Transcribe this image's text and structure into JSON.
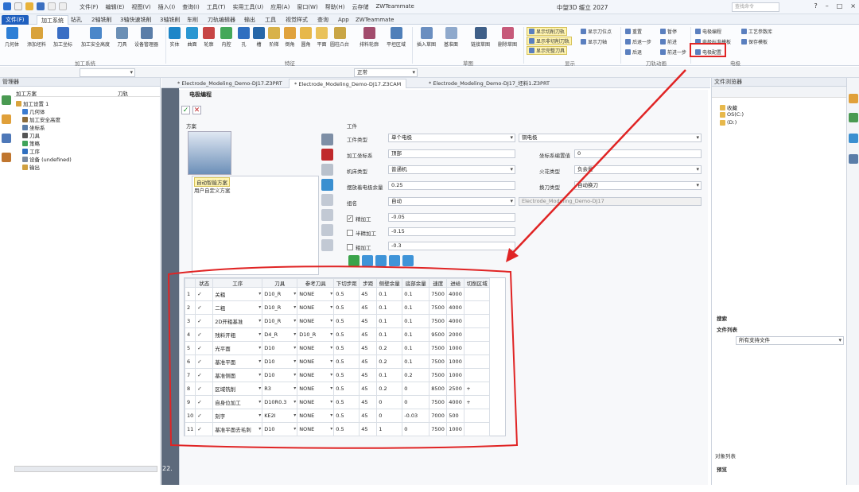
{
  "titlebar": {
    "menu": [
      "文件(F)",
      "编辑(E)",
      "视图(V)",
      "插入(I)",
      "查询(I)",
      "工具(T)",
      "实用工具(U)",
      "应用(A)",
      "窗口(W)",
      "帮助(H)",
      "云存储",
      "ZWTeammate"
    ],
    "title": "中望3D 缓立 2027",
    "search_placeholder": "查找命令"
  },
  "tabs": [
    "文件(F)",
    "加工系统",
    "钻孔",
    "2轴铣削",
    "3轴快速铣削",
    "3轴铣削",
    "车削",
    "刀轨编辑器",
    "输出",
    "工具",
    "视觉样式",
    "查询",
    "App",
    "ZWTeammate"
  ],
  "ribbon": {
    "machining": [
      "几何体",
      "添加坯料",
      "加工坐标",
      "加工安全高度",
      "刀具",
      "设备管理器"
    ],
    "machining_group": "加工系统",
    "features": [
      "实体",
      "曲面",
      "轮廓",
      "内腔",
      "孔",
      "槽",
      "阶梯",
      "倒角",
      "圆角",
      "平面",
      "圆柱凸台",
      "排料轮廓",
      "平坦区域"
    ],
    "features_group": "特征",
    "sketch": [
      "插入草图",
      "基准面",
      "链接草图",
      "删除草图"
    ],
    "sketch_group": "草图",
    "display": [
      "显示切削刀轨",
      "显示非切削刀轨",
      "显示完整刀具",
      "显示刀位点",
      "显示刀轴"
    ],
    "display_group": "显示",
    "toolpath_nav": [
      "重置",
      "暂停",
      "后退一步",
      "前进",
      "后退",
      "前进一步"
    ],
    "toolpath_group": "刀轨动画",
    "electrode": [
      "电极编程",
      "电极标准模板",
      "电极配置",
      "工艺参数库",
      "保存模板"
    ],
    "electrode_group": "电极"
  },
  "toolbar2": {
    "filter": "正常"
  },
  "manager": {
    "title": "管理器",
    "col1": "加工方案",
    "col2": "刀轨",
    "tree": [
      "加工设置 1",
      "几何体",
      "加工安全高度",
      "坐标系",
      "刀具",
      "策略",
      "工序",
      "设备 (undefined)",
      "输出"
    ]
  },
  "doc_tabs": [
    "* Electrode_Modeling_Demo-DJ17.Z3PRT",
    "* Electrode_Modeling_Demo-DJ17.Z3CAM",
    "* Electrode_Modeling_Demo-DJ17_坯料1.Z3PRT"
  ],
  "viewport_badge": "22.",
  "dialog": {
    "title": "电极编程",
    "plan_label": "方案",
    "plans": [
      "自动智能方案",
      "用户自定义方案"
    ],
    "work_label": "工件",
    "fields": {
      "work_type_label": "工件类型",
      "work_type": "单个电极",
      "work_type2": "铜电极",
      "coord_label": "加工坐标系",
      "coord": "顶部",
      "coord_num_label": "坐标系编置值",
      "coord_num": "0",
      "machine_label": "机床类型",
      "machine": "普通机",
      "spark_label": "火花类型",
      "spark": "负余量",
      "height_label": "摆放着电极余量",
      "height": "0.25",
      "tool_change_label": "换刀类型",
      "tool_change": "自动换刀",
      "group_label": "组名",
      "group": "自动",
      "group_name": "Electrode_Modeling_Demo-DJ17",
      "finish_label": "精加工",
      "finish": "-0.05",
      "semi_label": "半精加工",
      "semi": "-0.15",
      "rough_label": "粗加工",
      "rough": "-0.3"
    },
    "checks": {
      "finish": true,
      "semi": false,
      "rough": false
    },
    "grid": {
      "headers": [
        "",
        "状态",
        "工序",
        "刀具",
        "参考刀具",
        "下切步距",
        "步距",
        "侧壁余量",
        "底部余量",
        "速度",
        "进给",
        "切削区域"
      ],
      "rows": [
        [
          "1",
          "✓",
          "关粗",
          "D10_R",
          "NONE",
          "0.5",
          "45",
          "0.1",
          "0.1",
          "7500",
          "4000",
          ""
        ],
        [
          "2",
          "✓",
          "二粗",
          "D10_R",
          "NONE",
          "0.5",
          "45",
          "0.1",
          "0.1",
          "7500",
          "4000",
          ""
        ],
        [
          "3",
          "✓",
          "2D开粗基准",
          "D10_R",
          "NONE",
          "0.5",
          "45",
          "0.1",
          "0.1",
          "7500",
          "4000",
          ""
        ],
        [
          "4",
          "✓",
          "残料开粗",
          "D4_R",
          "D10_R",
          "0.5",
          "45",
          "0.1",
          "0.1",
          "9500",
          "2000",
          ""
        ],
        [
          "5",
          "✓",
          "光平面",
          "D10",
          "NONE",
          "0.5",
          "45",
          "0.2",
          "0.1",
          "7500",
          "1000",
          ""
        ],
        [
          "6",
          "✓",
          "基准平面",
          "D10",
          "NONE",
          "0.5",
          "45",
          "0.2",
          "0.1",
          "7500",
          "1000",
          ""
        ],
        [
          "7",
          "✓",
          "基准侧面",
          "D10",
          "NONE",
          "0.5",
          "45",
          "0.1",
          "0.2",
          "7500",
          "1000",
          ""
        ],
        [
          "8",
          "✓",
          "区域铣削",
          "R3",
          "NONE",
          "0.5",
          "45",
          "0.2",
          "0",
          "8500",
          "2500",
          "+"
        ],
        [
          "9",
          "✓",
          "自身位加工",
          "D10R0.3",
          "NONE",
          "0.5",
          "45",
          "0",
          "0",
          "7500",
          "4000",
          "+"
        ],
        [
          "10",
          "✓",
          "刻字",
          "KE2I",
          "NONE",
          "0.5",
          "45",
          "0",
          "-0.03",
          "7000",
          "500",
          ""
        ],
        [
          "11",
          "✓",
          "基准平面去毛刺",
          "D10",
          "NONE",
          "0.5",
          "45",
          "1",
          "0",
          "7500",
          "1000",
          ""
        ]
      ]
    }
  },
  "right_panel": {
    "title": "文件浏览器",
    "tree": [
      "收藏",
      "OS(C:)",
      "(D:)"
    ],
    "search": "搜索",
    "file_list": "文件列表",
    "all_files": "所有支持文件",
    "obj_list": "对象列表",
    "preview": "预览"
  },
  "annotation": {
    "color": "#e02424"
  }
}
